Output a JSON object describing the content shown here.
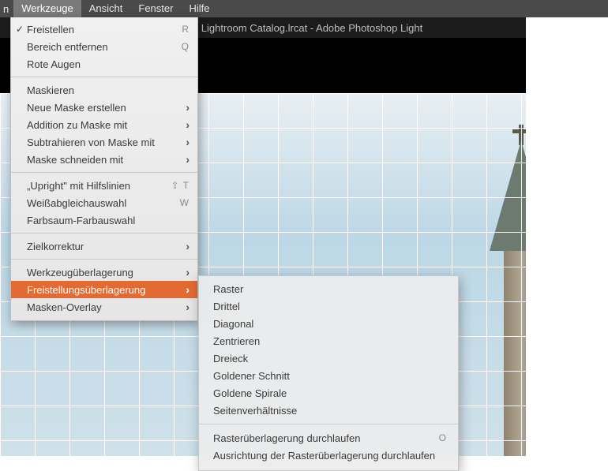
{
  "menubar": {
    "truncated": "n",
    "items": [
      "Werkzeuge",
      "Ansicht",
      "Fenster",
      "Hilfe"
    ],
    "active_index": 0
  },
  "title": "Lightroom Catalog.lrcat - Adobe Photoshop Light",
  "menu": {
    "group1": [
      {
        "label": "Freistellen",
        "checked": true,
        "shortcut": "R"
      },
      {
        "label": "Bereich entfernen",
        "shortcut": "Q"
      },
      {
        "label": "Rote Augen"
      }
    ],
    "group2": [
      {
        "label": "Maskieren"
      },
      {
        "label": "Neue Maske erstellen",
        "submenu": true
      },
      {
        "label": "Addition zu Maske mit",
        "submenu": true
      },
      {
        "label": "Subtrahieren von Maske mit",
        "submenu": true
      },
      {
        "label": "Maske schneiden mit",
        "submenu": true
      }
    ],
    "group3": [
      {
        "label": "„Upright\" mit Hilfslinien",
        "shortcut": "⇧ T"
      },
      {
        "label": "Weißabgleichauswahl",
        "shortcut": "W"
      },
      {
        "label": "Farbsaum-Farbauswahl"
      }
    ],
    "group4": [
      {
        "label": "Zielkorrektur",
        "submenu": true
      }
    ],
    "group5": [
      {
        "label": "Werkzeugüberlagerung",
        "submenu": true
      },
      {
        "label": "Freistellungsüberlagerung",
        "submenu": true,
        "highlight": true
      },
      {
        "label": "Masken-Overlay",
        "submenu": true
      }
    ]
  },
  "submenu": {
    "group1": [
      {
        "label": "Raster"
      },
      {
        "label": "Drittel"
      },
      {
        "label": "Diagonal"
      },
      {
        "label": "Zentrieren"
      },
      {
        "label": "Dreieck"
      },
      {
        "label": "Goldener Schnitt"
      },
      {
        "label": "Goldene Spirale"
      },
      {
        "label": "Seitenverhältnisse"
      }
    ],
    "group2": [
      {
        "label": "Rasterüberlagerung durchlaufen",
        "shortcut": "O"
      },
      {
        "label": "Ausrichtung der Rasterüberlagerung durchlaufen"
      }
    ]
  }
}
